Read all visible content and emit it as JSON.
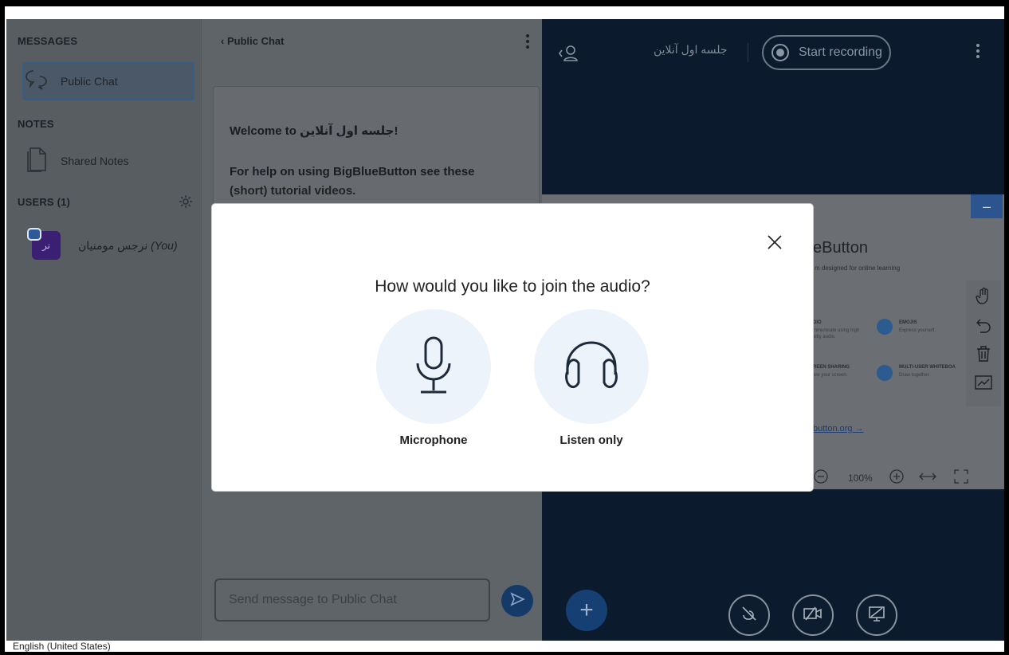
{
  "sidebar": {
    "messages_title": "MESSAGES",
    "public_chat_label": "Public Chat",
    "notes_title": "NOTES",
    "shared_notes_label": "Shared Notes",
    "users_title": "USERS (1)",
    "user": {
      "name": "نرجس مومنیان",
      "you_label": "(You)",
      "avatar_initials": "نر"
    }
  },
  "chat": {
    "header": "Public Chat",
    "welcome_line": "Welcome to جلسه اول آنلاین!",
    "help_line": "For help on using BigBlueButton see these",
    "help_line_cut": "(short) tutorial videos.",
    "input_placeholder": "Send message to Public Chat"
  },
  "main": {
    "meeting_title": "جلسه اول آنلاین",
    "record_label": "Start recording",
    "slide": {
      "title_fragment": "eButton",
      "subtitle_fragment": "m designed for online learning",
      "audio_label": "DIO",
      "audio_text": "mmunicate using high",
      "audio_text2": "ality audio.",
      "emojis_label": "EMOJIS",
      "emojis_text": "Express yourself.",
      "screen_label": "REEN SHARING",
      "screen_text": "are your screen.",
      "whiteboard_label": "MULTI-USER WHITEBOA",
      "whiteboard_text": "Draw together.",
      "link_fragment": "button.org →",
      "zoom_value": "100%"
    }
  },
  "modal": {
    "title": "How would you like to join the audio?",
    "microphone_label": "Microphone",
    "listen_only_label": "Listen only"
  },
  "statusbar": {
    "language": "English (United States)"
  },
  "colors": {
    "accent": "#2c558f",
    "modal_circle": "#edf3fb"
  }
}
